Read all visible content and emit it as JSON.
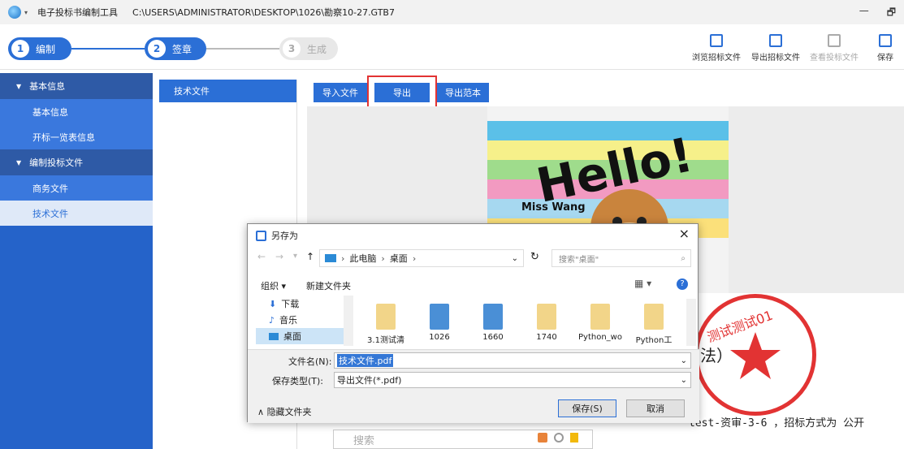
{
  "window": {
    "app_name": "电子投标书编制工具",
    "file_path": "C:\\USERS\\ADMINISTRATOR\\DESKTOP\\1026\\勘察10-27.GTB7",
    "minimize": "—",
    "restore": "🗗"
  },
  "steps": [
    {
      "num": "1",
      "label": "编制"
    },
    {
      "num": "2",
      "label": "签章"
    },
    {
      "num": "3",
      "label": "生成"
    }
  ],
  "toolbar": {
    "browse": "浏览招标文件",
    "export_bid": "导出招标文件",
    "view_bid": "查看投标文件",
    "save": "保存"
  },
  "sidebar": {
    "group1": "基本信息",
    "group1_items": [
      "基本信息",
      "开标一览表信息"
    ],
    "group2": "编制投标文件",
    "group2_items": [
      "商务文件",
      "技术文件"
    ]
  },
  "midpanel": {
    "selected": "技术文件"
  },
  "content": {
    "import_btn": "导入文件",
    "export_btn": "导出",
    "export_tpl_btn": "导出范本",
    "image_text_hello": "Hello!",
    "image_text_name": "Miss Wang",
    "heading_fragment": "法）",
    "line_fragment": "test-资审-3-6 ，招标方式为 公开",
    "search_placeholder": "搜索"
  },
  "stamp": {
    "text": "测试测试01"
  },
  "dialog": {
    "title": "另存为",
    "breadcrumb": [
      "此电脑",
      "桌面"
    ],
    "search_placeholder": "搜索\"桌面\"",
    "organize": "组织 ▾",
    "new_folder": "新建文件夹",
    "tree": [
      "下载",
      "音乐",
      "桌面"
    ],
    "files": [
      "3.1测试清",
      "1026",
      "1660",
      "1740",
      "Python_wo",
      "Python工"
    ],
    "filename_label": "文件名(N):",
    "filename_value": "技术文件.pdf",
    "filetype_label": "保存类型(T):",
    "filetype_value": "导出文件(*.pdf)",
    "hide_folders": "隐藏文件夹",
    "save_btn": "保存(S)",
    "cancel_btn": "取消"
  }
}
